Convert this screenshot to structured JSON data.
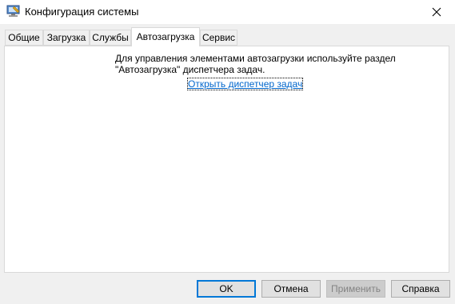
{
  "window": {
    "title": "Конфигурация системы"
  },
  "icons": {
    "app": "system-config-icon",
    "close": "close-icon"
  },
  "tabs": [
    {
      "label": "Общие",
      "active": false
    },
    {
      "label": "Загрузка",
      "active": false
    },
    {
      "label": "Службы",
      "active": false
    },
    {
      "label": "Автозагрузка",
      "active": true
    },
    {
      "label": "Сервис",
      "active": false
    }
  ],
  "startup": {
    "description_line1": "Для управления элементами автозагрузки используйте раздел",
    "description_line2": "\"Автозагрузка\" диспетчера задач.",
    "task_manager_link": "Открыть диспетчер задач"
  },
  "buttons": {
    "ok": "OK",
    "cancel": "Отмена",
    "apply": "Применить",
    "help": "Справка"
  },
  "colors": {
    "accent": "#0078d7",
    "link": "#0066cc"
  }
}
